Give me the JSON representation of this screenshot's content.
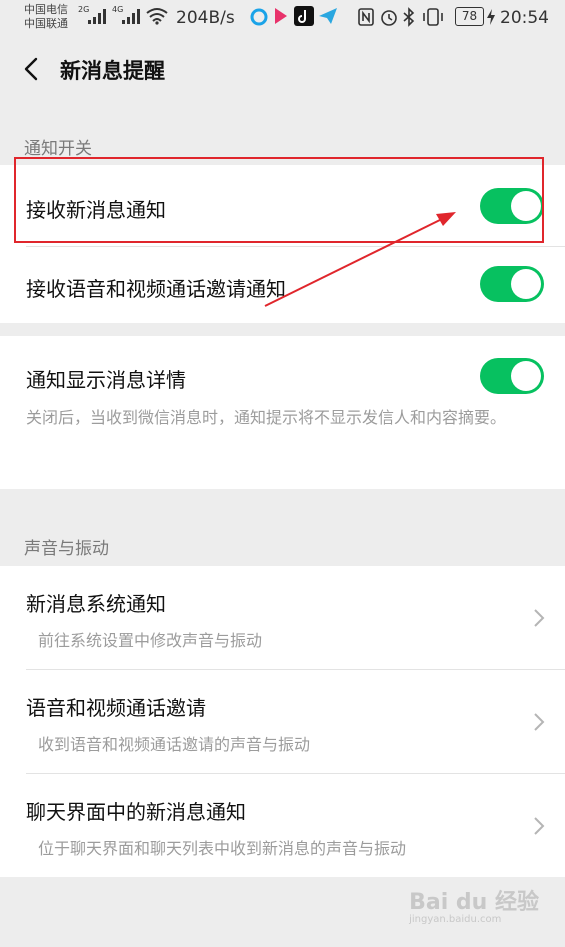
{
  "status_bar": {
    "carrier_1": "中国电信",
    "carrier_2": "中国联通",
    "net_1": "2G",
    "net_2": "4G",
    "speed": "204B/s",
    "battery": "78",
    "time": "20:54"
  },
  "header": {
    "title": "新消息提醒"
  },
  "notify_section": {
    "label": "通知开关",
    "rows": [
      {
        "label": "接收新消息通知",
        "enabled": true
      },
      {
        "label": "接收语音和视频通话邀请通知",
        "enabled": true
      }
    ]
  },
  "detail_section": {
    "label": "通知显示消息详情",
    "enabled": true,
    "description": "关闭后，当收到微信消息时，通知提示将不显示发信人和内容摘要。"
  },
  "sound_section": {
    "label": "声音与振动",
    "rows": [
      {
        "title": "新消息系统通知",
        "subtitle": "前往系统设置中修改声音与振动"
      },
      {
        "title": "语音和视频通话邀请",
        "subtitle": "收到语音和视频通话邀请的声音与振动"
      },
      {
        "title": "聊天界面中的新消息通知",
        "subtitle": "位于聊天界面和聊天列表中收到新消息的声音与振动"
      }
    ]
  },
  "watermark": {
    "brand": "Bai du 经验",
    "url": "jingyan.baidu.com"
  },
  "colors": {
    "toggle_on": "#07c160",
    "highlight": "#e0262c",
    "background": "#ededed"
  }
}
